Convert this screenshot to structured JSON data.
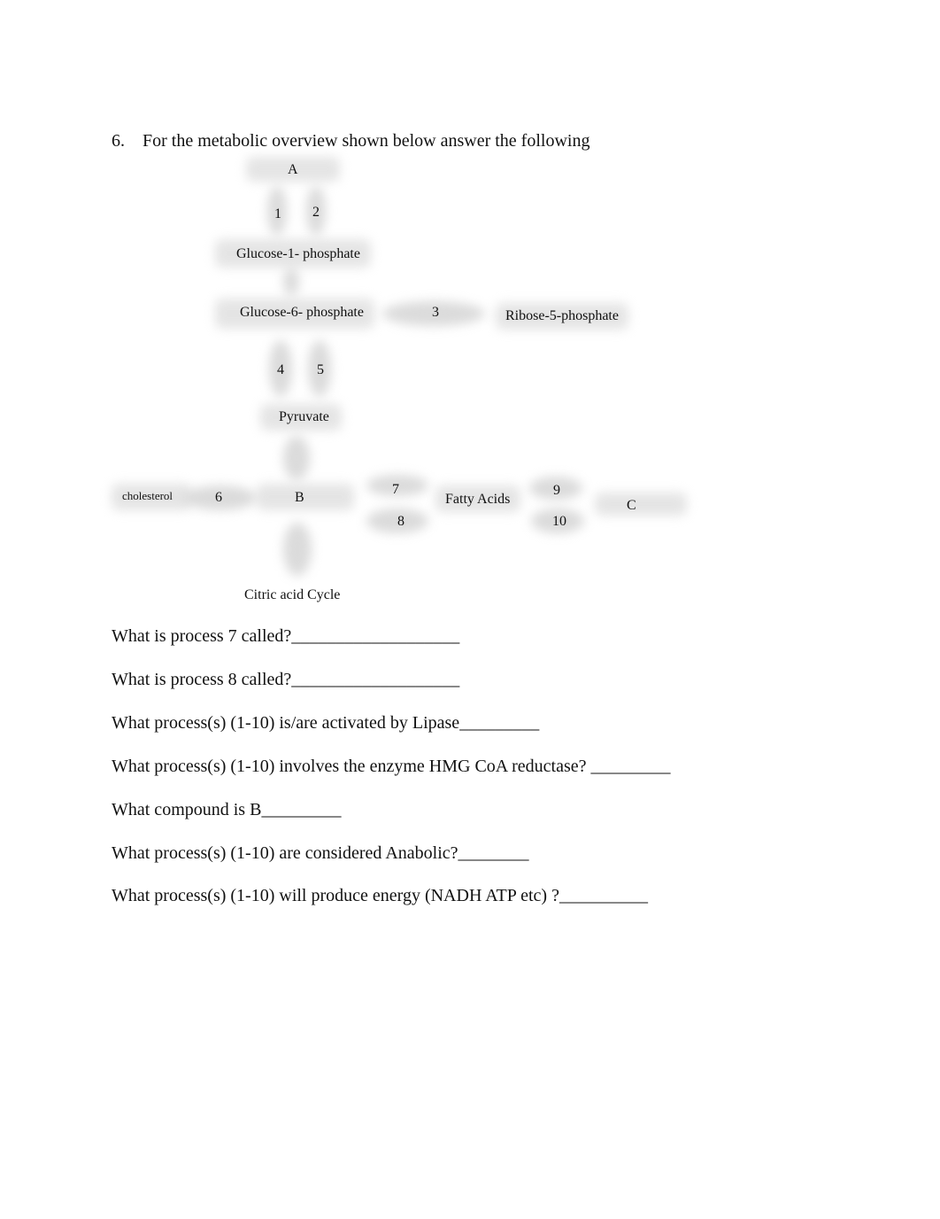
{
  "question": {
    "number": "6.",
    "prompt": "For the metabolic overview shown below answer the following"
  },
  "diagram": {
    "nodes": {
      "a": "A",
      "glucose1p": "Glucose-1- phosphate",
      "glucose6p": "Glucose-6- phosphate",
      "ribose5p": "Ribose-5-phosphate",
      "pyruvate": "Pyruvate",
      "cholesterol": "cholesterol",
      "b": "B",
      "fatty_acids": "Fatty Acids",
      "c": "C",
      "citric_acid_cycle": "Citric acid Cycle"
    },
    "processes": [
      "1",
      "2",
      "3",
      "4",
      "5",
      "6",
      "7",
      "8",
      "9",
      "10"
    ]
  },
  "sub_questions": [
    {
      "text": "What is process 7 called?",
      "blank": "___________________"
    },
    {
      "text": "What is process 8 called?",
      "blank": "___________________"
    },
    {
      "text": "What process(s) (1-10) is/are activated by Lipase",
      "blank": "_________"
    },
    {
      "text": "What process(s) (1-10) involves the enzyme HMG CoA reductase? ",
      "blank": "_________"
    },
    {
      "text": "What compound is B",
      "blank": "_________"
    },
    {
      "text": "What process(s) (1-10) are considered Anabolic?",
      "blank": "________"
    },
    {
      "text": "What process(s) (1-10) will produce energy (NADH ATP etc) ?",
      "blank": "__________"
    }
  ]
}
